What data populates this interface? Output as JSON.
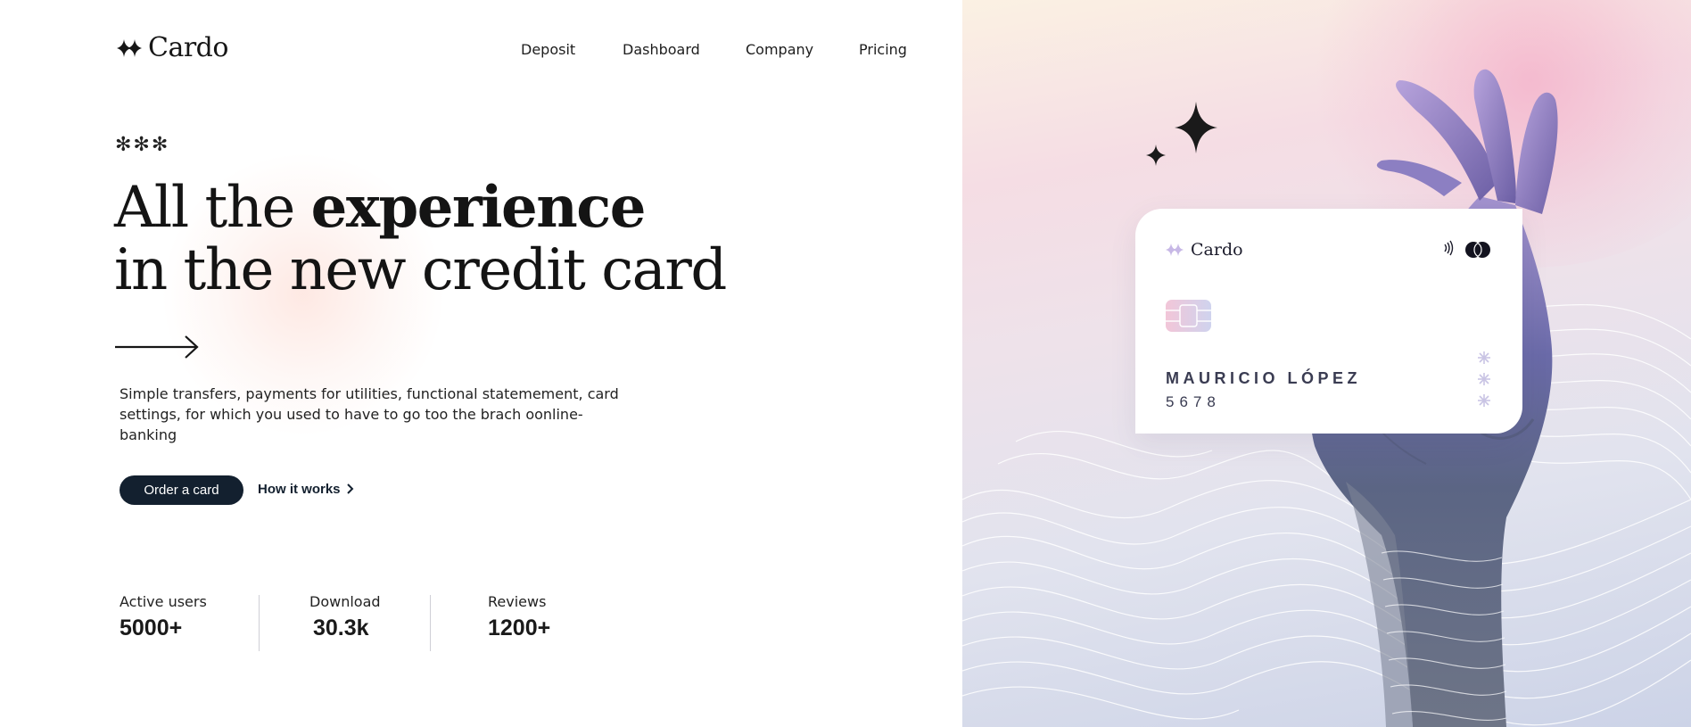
{
  "brand": {
    "name": "Cardo",
    "icon": "four-point-star-icon"
  },
  "nav": {
    "items": [
      "Deposit",
      "Dashboard",
      "Company",
      "Pricing"
    ]
  },
  "hero": {
    "decoration": "✻✻✻",
    "headline_line1_light": "All the ",
    "headline_line1_bold": "experience",
    "headline_line2": "in the new credit card",
    "arrow_icon": "long-arrow-right-icon",
    "description": "Simple transfers, payments for utilities, functional statemement, card settings, for which you used to have to go too the brach oonline-banking",
    "primary_button": "Order a card",
    "secondary_link": "How it works",
    "secondary_link_icon": "chevron-right-icon"
  },
  "stats": [
    {
      "label": "Active users",
      "value": "5000+"
    },
    {
      "label": "Download",
      "value": "30.3k"
    },
    {
      "label": "Reviews",
      "value": "1200+"
    }
  ],
  "card": {
    "brand": "Cardo",
    "holder": "MAURICIO LÓPEZ",
    "number": "5678",
    "icons": [
      "contactless-icon",
      "card-network-icon",
      "chip-icon"
    ]
  },
  "colors": {
    "primary": "#13202f",
    "text": "#161616",
    "card_text": "#3a3c52",
    "accent_pink": "#f4a8c4",
    "accent_lavender": "#ccd3e7"
  }
}
